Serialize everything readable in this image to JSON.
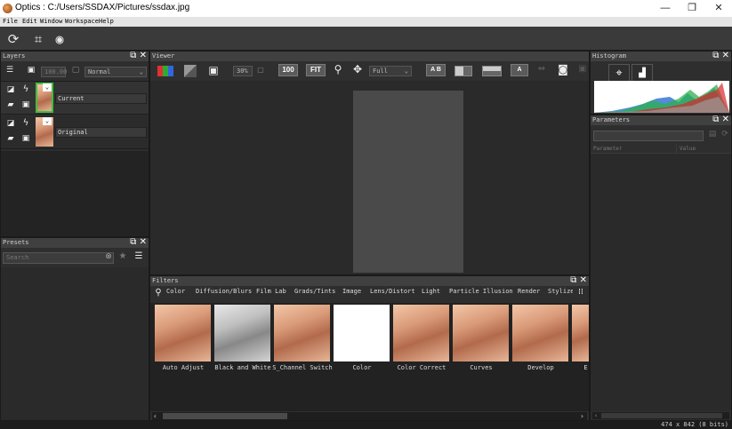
{
  "window": {
    "title": "Optics : C:/Users/SSDAX/Pictures/ssdax.jpg",
    "minimize": "—",
    "restore": "❐",
    "close": "✕"
  },
  "menu": [
    "File",
    "Edit",
    "Window",
    "Workspace",
    "Help"
  ],
  "layers": {
    "title": "Layers",
    "opacity": "100.00",
    "blend_mode": "Normal",
    "items": [
      {
        "name": "Current"
      },
      {
        "name": "Original"
      }
    ]
  },
  "presets": {
    "title": "Presets",
    "search_placeholder": "Search"
  },
  "viewer": {
    "title": "Viewer",
    "zoom": "30%",
    "btn_100": "100",
    "btn_fit": "FIT",
    "mode": "Full",
    "ab_label": "A B"
  },
  "filters": {
    "title": "Filters",
    "tabs": [
      "Color",
      "Diffusion/Blurs",
      "Film Lab",
      "Grads/Tints",
      "Image",
      "Lens/Distort",
      "Light",
      "Particle Illusion",
      "Render",
      "Stylize"
    ],
    "items": [
      "Auto Adjust",
      "Black and White",
      "S_Channel Switch",
      "Color",
      "Color Correct",
      "Curves",
      "Develop",
      "E"
    ]
  },
  "histogram": {
    "title": "Histogram"
  },
  "parameters": {
    "title": "Parameters",
    "col_param": "Parameter",
    "col_value": "Value"
  },
  "status": {
    "text": "474 x 842 (8 bits)"
  },
  "colors": {
    "accent_green": "#3fbf3f",
    "panel_bg": "#2e2e2e",
    "canvas_bg": "#4a4a4a"
  }
}
